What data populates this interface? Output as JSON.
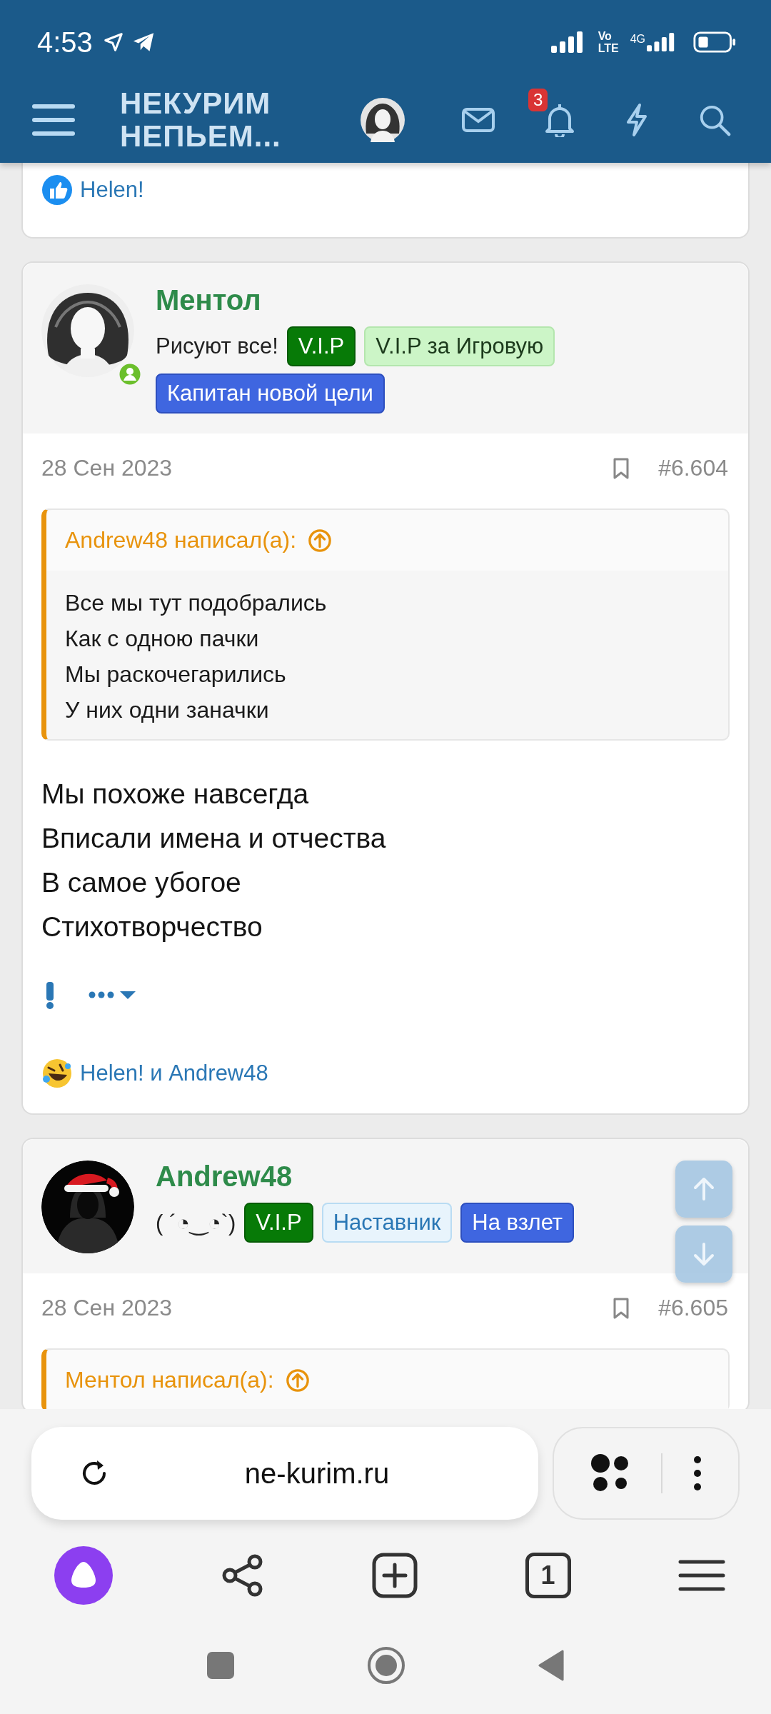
{
  "status_bar": {
    "time": "4:53",
    "volte_top": "Vo",
    "volte_bottom": "LTE",
    "network": "4G"
  },
  "header": {
    "logo_lines": [
      "НЕКУРИМ",
      "НЕПЬЕМ..."
    ],
    "notifications_count": "3"
  },
  "previous_post": {
    "reaction": {
      "kind": "like",
      "users": "Helen!"
    }
  },
  "posts": [
    {
      "author": "Ментол",
      "avatar": {
        "kind": "picture"
      },
      "online": true,
      "signature": "Рисуют все!",
      "badges": [
        {
          "text": "V.I.P",
          "kind": "vip"
        },
        {
          "text": "V.I.P за Игровую",
          "kind": "light-green"
        },
        {
          "text": "Капитан новой цели",
          "kind": "blue"
        }
      ],
      "date": "28 Сен 2023",
      "number": "#6.604",
      "quote": {
        "author_line": "Andrew48 написал(а):",
        "lines": [
          "Все мы тут подобрались",
          "Как с одною пачки",
          "Мы раскочегарились",
          "У них одни заначки"
        ]
      },
      "body": [
        "Мы похоже навсегда",
        "Вписали имена и отчества",
        "В самое убогое",
        "Стихотворчество"
      ],
      "reaction": {
        "kind": "laugh",
        "users": "Helen! и Andrew48"
      }
    },
    {
      "author": "Andrew48",
      "avatar": {
        "kind": "picture"
      },
      "online": false,
      "signature": "( ´◔‿◔`)",
      "badges": [
        {
          "text": "V.I.P",
          "kind": "vip"
        },
        {
          "text": "Наставник",
          "kind": "light-blue"
        },
        {
          "text": "На взлет",
          "kind": "blue"
        }
      ],
      "date": "28 Сен 2023",
      "number": "#6.605",
      "quote": {
        "author_line": "Ментол написал(а):"
      }
    }
  ],
  "browser": {
    "url": "ne-kurim.ru",
    "tabs_count": "1"
  }
}
